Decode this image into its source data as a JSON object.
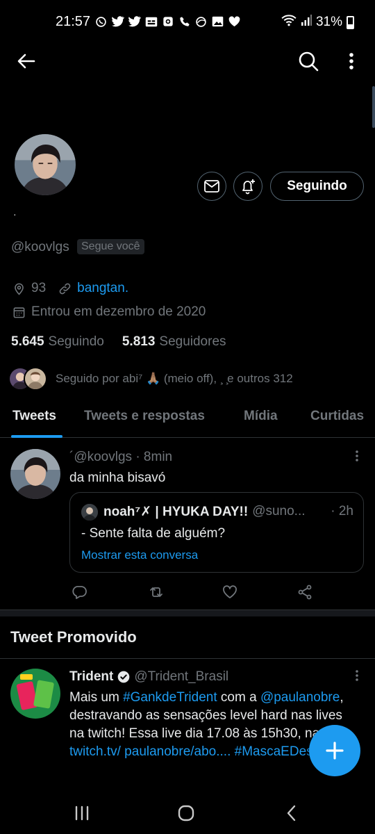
{
  "status_bar": {
    "time": "21:57",
    "battery": "31%",
    "notification_icons": [
      "whatsapp-icon",
      "twitter-icon",
      "twitter-icon",
      "subtitles-icon",
      "camera-app-icon",
      "phone-icon",
      "browser-icon",
      "gallery-icon",
      "heart-icon"
    ]
  },
  "profile": {
    "display_name": "·",
    "handle": "@koovlgs",
    "follows_you": "Segue você",
    "location": "93",
    "website": "bangtan.",
    "joined": "Entrou em dezembro de 2020",
    "following_count": "5.645",
    "following_label": "Seguindo",
    "followers_count": "5.813",
    "followers_label": "Seguidores",
    "followed_by": "Seguido por abi⁷ 🙏🏽 (meio off), ¸ ̧e outros 312",
    "follow_button": "Seguindo"
  },
  "tabs": [
    {
      "label": "Tweets",
      "active": true
    },
    {
      "label": "Tweets e respostas",
      "active": false
    },
    {
      "label": "Mídia",
      "active": false
    },
    {
      "label": "Curtidas",
      "active": false
    }
  ],
  "tweet": {
    "header": "´@koovlgs · 8min",
    "text": "da minha bisavó",
    "quote": {
      "name": "noah⁷✗ | HYUKA DAY!!",
      "handle": "@suno...",
      "time": "· 2h",
      "text": "- Sente falta de alguém?",
      "link": "Mostrar esta conversa"
    }
  },
  "promoted": {
    "title": "Tweet Promovido",
    "name": "Trident",
    "handle": "@Trident_Brasil",
    "text_parts": {
      "p1": "Mais um ",
      "h1": "#GankdeTrident",
      "p2": " com a ",
      "h2": "@paulanobre",
      "p3": ", destravando as sensações level hard nas lives na twitch! Essa live dia 17.08 às 15h30, na ",
      "h3": "twitch.tv/ paulanobre/abo....",
      "p4": " ",
      "h4": "#MascaEDestrava"
    }
  },
  "colors": {
    "accent": "#1d9bf0",
    "background": "#000000",
    "muted_text": "#71767b",
    "border": "#2f3336"
  }
}
